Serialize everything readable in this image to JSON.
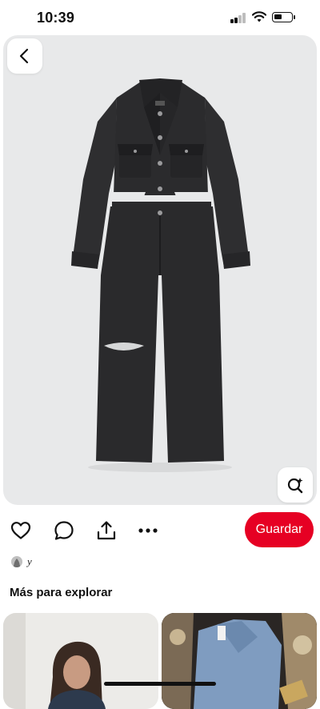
{
  "status_bar": {
    "time": "10:39"
  },
  "pin": {
    "creator_name": "y"
  },
  "actions": {
    "save_label": "Guardar"
  },
  "explore": {
    "title": "Más para explorar"
  },
  "colors": {
    "accent": "#e60023",
    "image_bg": "#e8e9ea",
    "garment": "#2b2b2d"
  },
  "icons": [
    "back-arrow-icon",
    "visual-search-icon",
    "heart-icon",
    "comment-icon",
    "share-icon",
    "more-icon"
  ]
}
